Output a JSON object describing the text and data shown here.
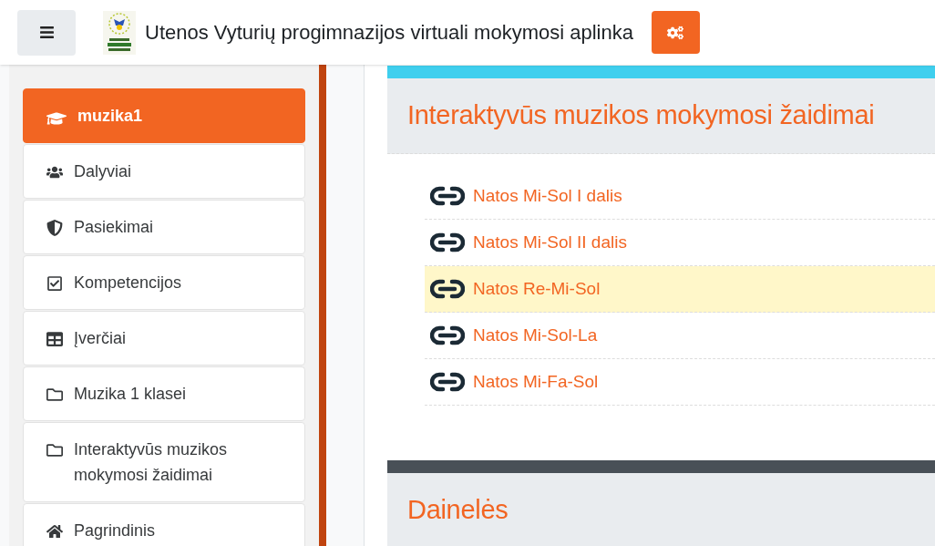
{
  "header": {
    "site_title": "Utenos Vyturių progimnazijos virtuali mokymosi aplinka"
  },
  "sidebar": {
    "items": [
      {
        "label": "muzika1",
        "kind": "course",
        "selected": true
      },
      {
        "label": "Dalyviai",
        "kind": "users",
        "selected": false
      },
      {
        "label": "Pasiekimai",
        "kind": "shield",
        "selected": false
      },
      {
        "label": "Kompetencijos",
        "kind": "check",
        "selected": false
      },
      {
        "label": "Įverčiai",
        "kind": "table",
        "selected": false
      },
      {
        "label": "Muzika 1 klasei",
        "kind": "folder",
        "selected": false
      },
      {
        "label": "Interaktyvūs muzikos mokymosi žaidimai",
        "kind": "folder",
        "selected": false
      },
      {
        "label": "Pagrindinis",
        "kind": "home",
        "selected": false
      }
    ]
  },
  "sections": [
    {
      "title": "Interaktyvūs muzikos mokymosi žaidimai",
      "color": "#3fcfee",
      "links": [
        {
          "label": "Natos Mi-Sol I dalis",
          "highlighted": false
        },
        {
          "label": "Natos Mi-Sol II dalis",
          "highlighted": false
        },
        {
          "label": "Natos Re-Mi-Sol",
          "highlighted": true
        },
        {
          "label": "Natos Mi-Sol-La",
          "highlighted": false
        },
        {
          "label": "Natos Mi-Fa-Sol",
          "highlighted": false
        }
      ]
    },
    {
      "title": "Dainelės",
      "color": "#495057"
    }
  ]
}
